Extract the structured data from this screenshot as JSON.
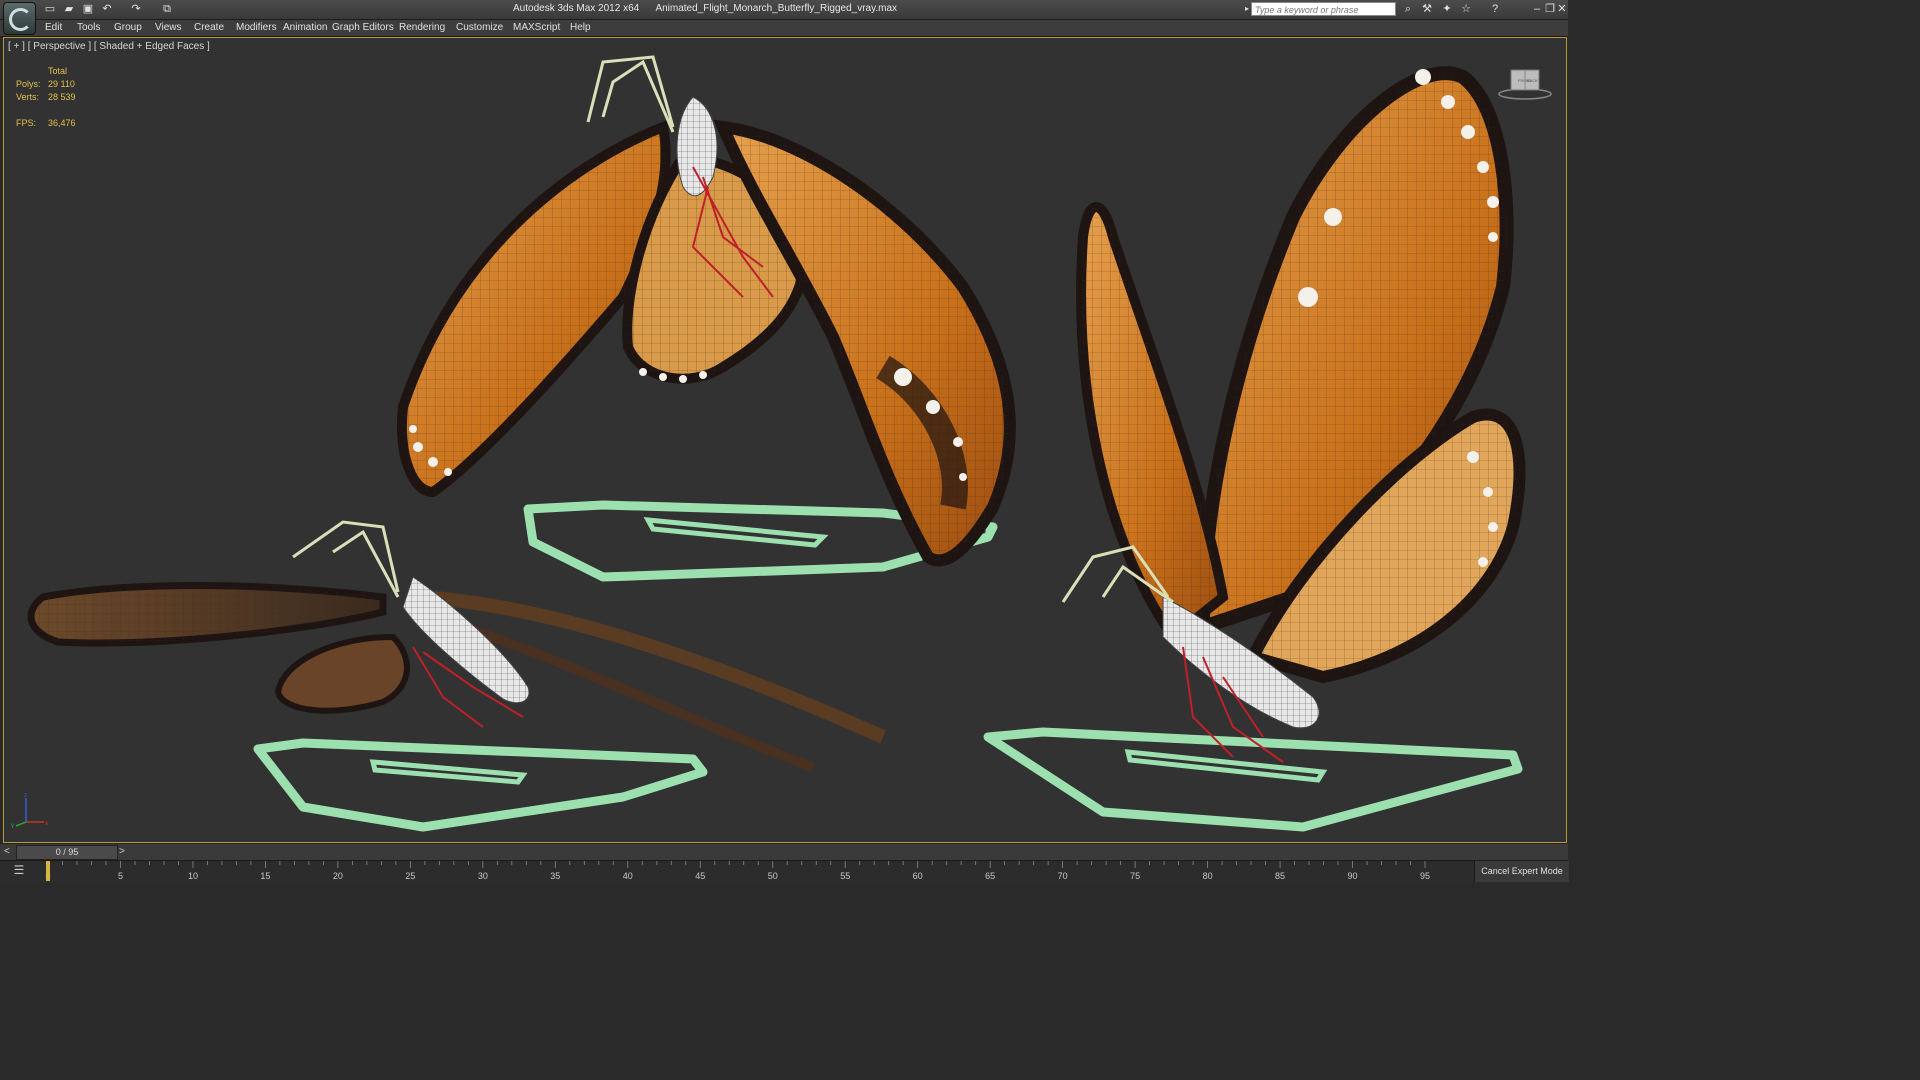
{
  "titlebar": {
    "app": "Autodesk 3ds Max  2012 x64",
    "file": "Animated_Flight_Monarch_Butterfly_Rigged_vray.max",
    "search_placeholder": "Type a keyword or phrase"
  },
  "menubar": {
    "items": [
      "Edit",
      "Tools",
      "Group",
      "Views",
      "Create",
      "Modifiers",
      "Animation",
      "Graph Editors",
      "Rendering",
      "Customize",
      "MAXScript",
      "Help"
    ]
  },
  "viewport": {
    "label": "[ + ] [ Perspective ] [ Shaded + Edged Faces ]",
    "stats": {
      "total_label": "Total",
      "polys_label": "Polys:",
      "polys_value": "29 110",
      "verts_label": "Verts:",
      "verts_value": "28 539",
      "fps_label": "FPS:",
      "fps_value": "36,476"
    },
    "viewcube_labels": [
      "FRONT",
      "BACK"
    ],
    "axis_labels": [
      "x",
      "y",
      "z"
    ]
  },
  "timeline": {
    "left_arrow": "<",
    "slider": "0 / 95",
    "right_arrow": ">",
    "ticks": [
      "0",
      "5",
      "10",
      "15",
      "20",
      "25",
      "30",
      "35",
      "40",
      "45",
      "50",
      "55",
      "60",
      "65",
      "70",
      "75",
      "80",
      "85",
      "90",
      "95"
    ],
    "expert_mode": "Cancel Expert Mode"
  },
  "colors": {
    "wing_orange": "#d07a1e",
    "wing_black": "#1e1412",
    "helper_green": "#8fd9a0",
    "bone_red": "#c0202a",
    "viewport_border": "#b79a32",
    "stat_text": "#e3c04b"
  },
  "icons": {
    "app_button": "3dsmax-logo-icon",
    "quick_access": [
      "new-icon",
      "open-icon",
      "save-icon",
      "undo-icon",
      "redo-icon",
      "project-icon"
    ],
    "info_center": [
      "binoculars-icon",
      "wrench-icon",
      "satellite-icon",
      "star-icon",
      "help-icon"
    ],
    "window": [
      "minimize-icon",
      "restore-icon",
      "close-icon"
    ]
  }
}
